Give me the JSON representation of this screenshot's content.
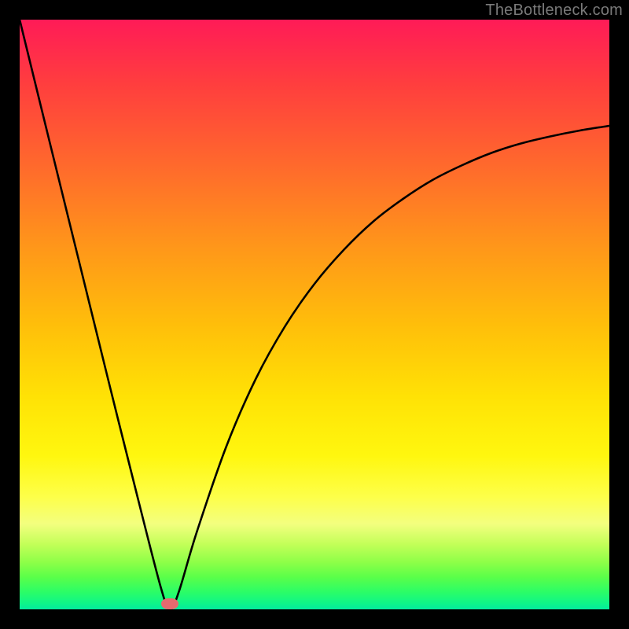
{
  "watermark": "TheBottleneck.com",
  "chart_data": {
    "type": "line",
    "title": "",
    "xlabel": "",
    "ylabel": "",
    "xlim": [
      0,
      100
    ],
    "ylim": [
      0,
      100
    ],
    "grid": false,
    "legend": false,
    "series": [
      {
        "name": "bottleneck-curve",
        "x": [
          0,
          5,
          10,
          15,
          20,
          24,
          25.5,
          27,
          30,
          35,
          40,
          45,
          50,
          55,
          60,
          65,
          70,
          75,
          80,
          85,
          90,
          95,
          100
        ],
        "y": [
          100,
          79.6,
          59.3,
          39.0,
          19.0,
          3.5,
          0.0,
          3.0,
          13.0,
          27.5,
          39.0,
          48.0,
          55.2,
          61.0,
          65.8,
          69.6,
          72.8,
          75.3,
          77.4,
          79.0,
          80.2,
          81.2,
          82.0
        ]
      }
    ],
    "annotations": [
      {
        "name": "minimum-marker",
        "x": 25.5,
        "y": 1.0,
        "color": "#e76a6f"
      }
    ],
    "background_gradient": {
      "orientation": "vertical",
      "stops": [
        {
          "pos": 0.0,
          "color": "#ff1b57"
        },
        {
          "pos": 0.11,
          "color": "#ff3e3e"
        },
        {
          "pos": 0.25,
          "color": "#ff6a2c"
        },
        {
          "pos": 0.39,
          "color": "#ff9819"
        },
        {
          "pos": 0.52,
          "color": "#ffbf0a"
        },
        {
          "pos": 0.64,
          "color": "#ffe205"
        },
        {
          "pos": 0.74,
          "color": "#fff70f"
        },
        {
          "pos": 0.81,
          "color": "#fdff4a"
        },
        {
          "pos": 0.855,
          "color": "#f3ff7f"
        },
        {
          "pos": 0.89,
          "color": "#c2ff58"
        },
        {
          "pos": 0.92,
          "color": "#8eff48"
        },
        {
          "pos": 0.945,
          "color": "#5bff49"
        },
        {
          "pos": 0.97,
          "color": "#2cfd66"
        },
        {
          "pos": 0.99,
          "color": "#0ef589"
        },
        {
          "pos": 1.0,
          "color": "#04ea9e"
        }
      ]
    }
  }
}
